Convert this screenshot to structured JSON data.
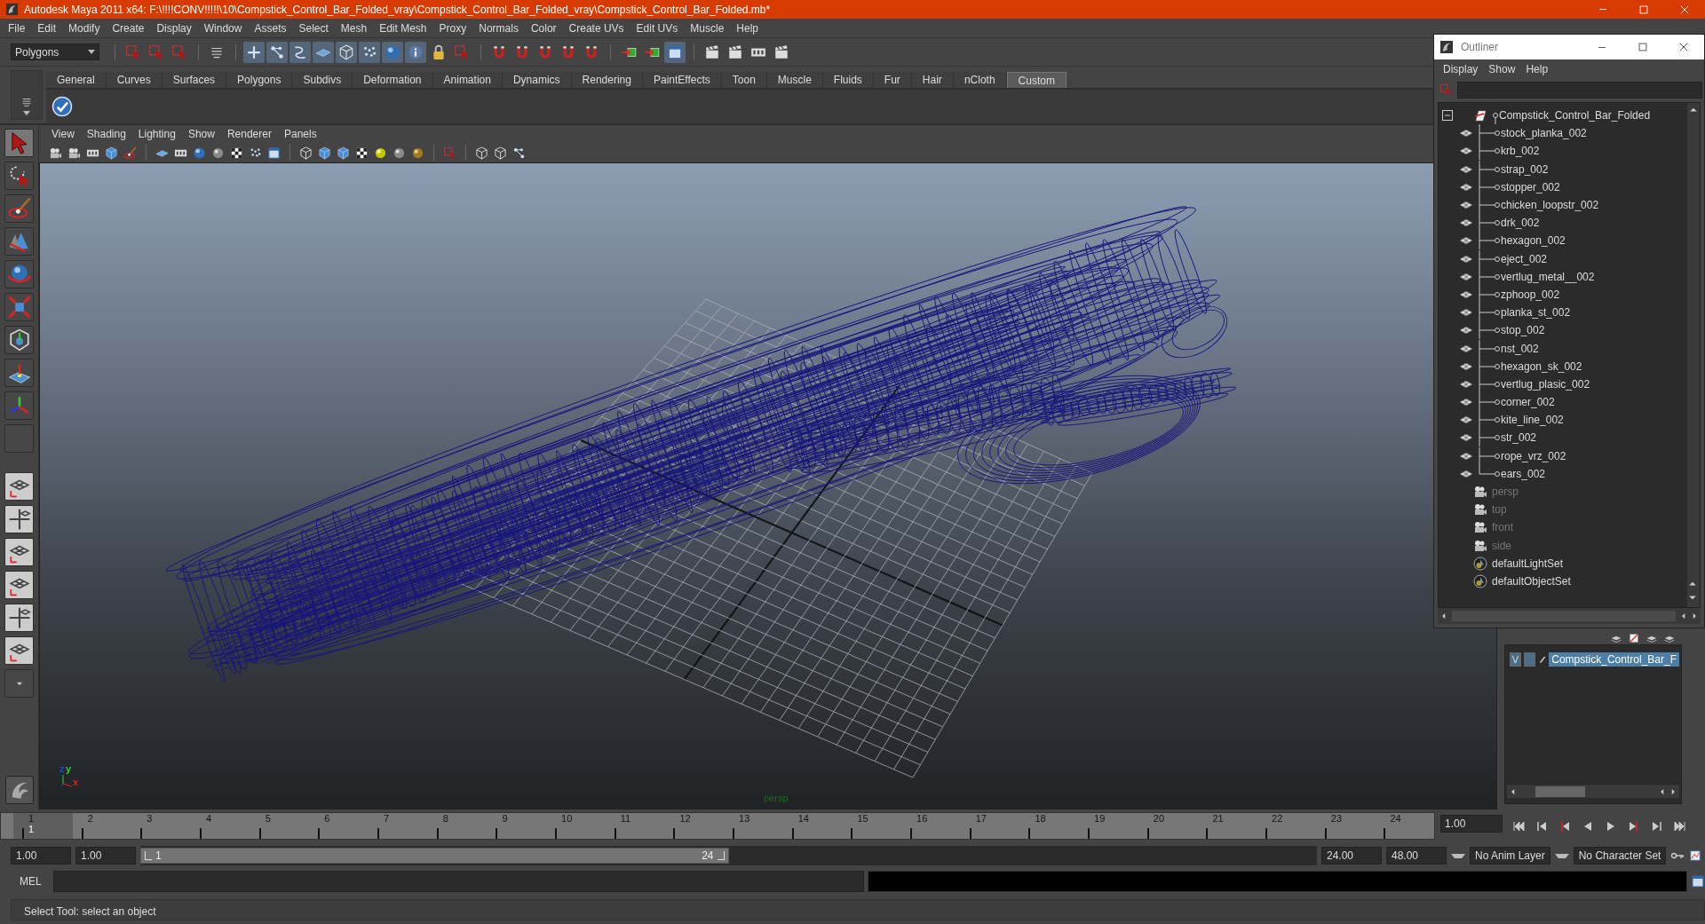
{
  "window": {
    "title": "Autodesk Maya 2011 x64: F:\\!!!!CONV!!!!!\\10\\Compstick_Control_Bar_Folded_vray\\Compstick_Control_Bar_Folded_vray\\Compstick_Control_Bar_Folded.mb*"
  },
  "menu_bar": [
    "File",
    "Edit",
    "Modify",
    "Create",
    "Display",
    "Window",
    "Assets",
    "Select",
    "Mesh",
    "Edit Mesh",
    "Proxy",
    "Normals",
    "Color",
    "Create UVs",
    "Edit UVs",
    "Muscle",
    "Help"
  ],
  "status_line": {
    "mode": "Polygons"
  },
  "shelf": {
    "tabs": [
      {
        "label": "General",
        "selected": false
      },
      {
        "label": "Curves",
        "selected": false
      },
      {
        "label": "Surfaces",
        "selected": false
      },
      {
        "label": "Polygons",
        "selected": false
      },
      {
        "label": "Subdivs",
        "selected": false
      },
      {
        "label": "Deformation",
        "selected": false
      },
      {
        "label": "Animation",
        "selected": false
      },
      {
        "label": "Dynamics",
        "selected": false
      },
      {
        "label": "Rendering",
        "selected": false
      },
      {
        "label": "PaintEffects",
        "selected": false
      },
      {
        "label": "Toon",
        "selected": false
      },
      {
        "label": "Muscle",
        "selected": false
      },
      {
        "label": "Fluids",
        "selected": false
      },
      {
        "label": "Fur",
        "selected": false
      },
      {
        "label": "Hair",
        "selected": false
      },
      {
        "label": "nCloth",
        "selected": false
      },
      {
        "label": "Custom",
        "selected": true
      }
    ]
  },
  "viewport": {
    "menu": [
      "View",
      "Shading",
      "Lighting",
      "Show",
      "Renderer",
      "Panels"
    ],
    "camera_label": "persp",
    "axis_labels": [
      "z",
      "y",
      "x"
    ]
  },
  "outliner": {
    "title": "Outliner",
    "menu": [
      "Display",
      "Show",
      "Help"
    ],
    "items": [
      {
        "label": "Compstick_Control_Bar_Folded",
        "kind": "group",
        "hidden": false,
        "expanded": true,
        "children": [
          {
            "label": "stock_planka_002",
            "kind": "mesh",
            "hidden": false
          },
          {
            "label": "krb_002",
            "kind": "mesh",
            "hidden": false
          },
          {
            "label": "strap_002",
            "kind": "mesh",
            "hidden": false
          },
          {
            "label": "stopper_002",
            "kind": "mesh",
            "hidden": false
          },
          {
            "label": "chicken_loopstr_002",
            "kind": "mesh",
            "hidden": false
          },
          {
            "label": "drk_002",
            "kind": "mesh",
            "hidden": false
          },
          {
            "label": "hexagon_002",
            "kind": "mesh",
            "hidden": false
          },
          {
            "label": "eject_002",
            "kind": "mesh",
            "hidden": false
          },
          {
            "label": "vertlug_metal__002",
            "kind": "mesh",
            "hidden": false
          },
          {
            "label": "zphoop_002",
            "kind": "mesh",
            "hidden": false
          },
          {
            "label": "planka_st_002",
            "kind": "mesh",
            "hidden": false
          },
          {
            "label": "stop_002",
            "kind": "mesh",
            "hidden": false
          },
          {
            "label": "nst_002",
            "kind": "mesh",
            "hidden": false
          },
          {
            "label": "hexagon_sk_002",
            "kind": "mesh",
            "hidden": false
          },
          {
            "label": "vertlug_plasic_002",
            "kind": "mesh",
            "hidden": false
          },
          {
            "label": "corner_002",
            "kind": "mesh",
            "hidden": false
          },
          {
            "label": "kite_line_002",
            "kind": "mesh",
            "hidden": false
          },
          {
            "label": "str_002",
            "kind": "mesh",
            "hidden": false
          },
          {
            "label": "rope_vrz_002",
            "kind": "mesh",
            "hidden": false
          },
          {
            "label": "ears_002",
            "kind": "mesh",
            "hidden": false
          }
        ]
      },
      {
        "label": "persp",
        "kind": "camera",
        "hidden": true
      },
      {
        "label": "top",
        "kind": "camera",
        "hidden": true
      },
      {
        "label": "front",
        "kind": "camera",
        "hidden": true
      },
      {
        "label": "side",
        "kind": "camera",
        "hidden": true
      },
      {
        "label": "defaultLightSet",
        "kind": "set",
        "hidden": false
      },
      {
        "label": "defaultObjectSet",
        "kind": "set",
        "hidden": false
      }
    ]
  },
  "layer_editor": {
    "layers": [
      {
        "visibility": "V",
        "name": "Compstick_Control_Bar_F",
        "selected": true
      }
    ]
  },
  "time_slider": {
    "ticks": [
      {
        "label": "1",
        "current": true
      },
      {
        "label": "2",
        "current": false
      },
      {
        "label": "3",
        "current": false
      },
      {
        "label": "4",
        "current": false
      },
      {
        "label": "5",
        "current": false
      },
      {
        "label": "6",
        "current": false
      },
      {
        "label": "7",
        "current": false
      },
      {
        "label": "8",
        "current": false
      },
      {
        "label": "9",
        "current": false
      },
      {
        "label": "10",
        "current": false
      },
      {
        "label": "11",
        "current": false
      },
      {
        "label": "12",
        "current": false
      },
      {
        "label": "13",
        "current": false
      },
      {
        "label": "14",
        "current": false
      },
      {
        "label": "15",
        "current": false
      },
      {
        "label": "16",
        "current": false
      },
      {
        "label": "17",
        "current": false
      },
      {
        "label": "18",
        "current": false
      },
      {
        "label": "19",
        "current": false
      },
      {
        "label": "20",
        "current": false
      },
      {
        "label": "21",
        "current": false
      },
      {
        "label": "22",
        "current": false
      },
      {
        "label": "23",
        "current": false
      },
      {
        "label": "24",
        "current": false
      }
    ],
    "current_frame": "1",
    "current_time": "1.00"
  },
  "range_slider": {
    "start_time": "1.00",
    "playback_start": "1.00",
    "range_start": "1",
    "range_end": "24",
    "level": 0.5,
    "playback_end": "24.00",
    "end_time": "48.00",
    "anim_layer": "No Anim Layer",
    "character_set": "No Character Set"
  },
  "command_line": {
    "language": "MEL"
  },
  "help_line": {
    "text": "Select Tool: select an object"
  }
}
